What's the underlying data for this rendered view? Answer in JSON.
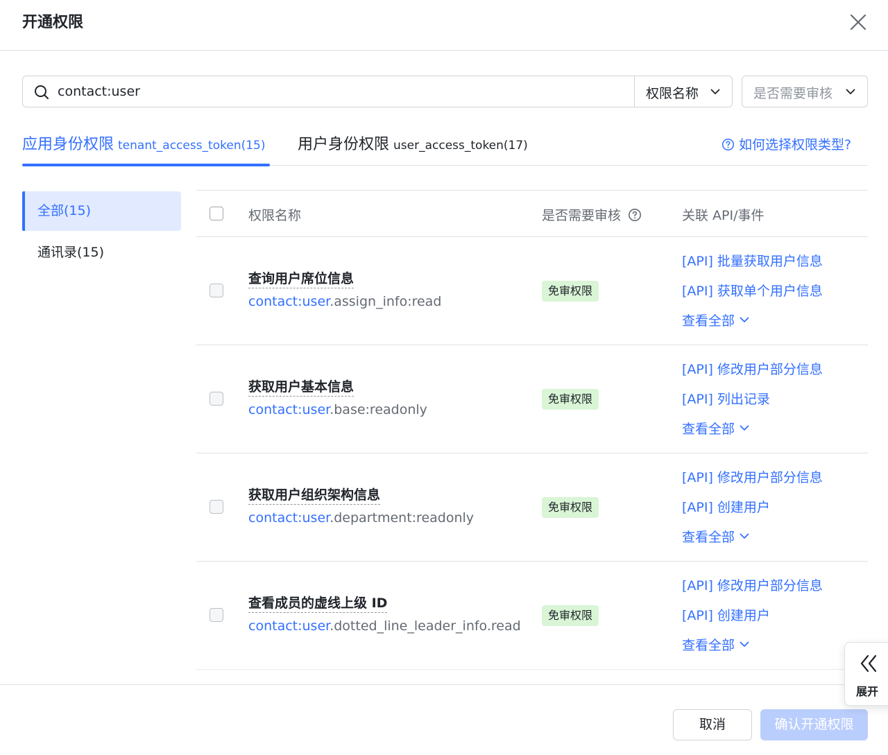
{
  "dialog": {
    "title": "开通权限"
  },
  "search": {
    "value": "contact:user"
  },
  "filters": {
    "field": "权限名称",
    "review": "是否需要审核"
  },
  "tabs": [
    {
      "label": "应用身份权限",
      "token": "tenant_access_token(15)"
    },
    {
      "label": "用户身份权限",
      "token": "user_access_token(17)"
    }
  ],
  "help": {
    "label": "如何选择权限类型?"
  },
  "sidebar": {
    "items": [
      {
        "label": "全部(15)"
      },
      {
        "label": "通讯录(15)"
      }
    ]
  },
  "table": {
    "headers": {
      "name": "权限名称",
      "review": "是否需要审核",
      "api": "关联 API/事件"
    },
    "rows": [
      {
        "name": "查询用户席位信息",
        "code_hl": "contact:user",
        "code_rest": ".assign_info:read",
        "badge": "免审权限",
        "api1": "[API] 批量获取用户信息",
        "api2": "[API] 获取单个用户信息",
        "more": "查看全部"
      },
      {
        "name": "获取用户基本信息",
        "code_hl": "contact:user",
        "code_rest": ".base:readonly",
        "badge": "免审权限",
        "api1": "[API] 修改用户部分信息",
        "api2": "[API] 列出记录",
        "more": "查看全部"
      },
      {
        "name": "获取用户组织架构信息",
        "code_hl": "contact:user",
        "code_rest": ".department:readonly",
        "badge": "免审权限",
        "api1": "[API] 修改用户部分信息",
        "api2": "[API] 创建用户",
        "more": "查看全部"
      },
      {
        "name": "查看成员的虚线上级 ID",
        "code_hl": "contact:user",
        "code_rest": ".dotted_line_leader_info.read",
        "badge": "免审权限",
        "api1": "[API] 修改用户部分信息",
        "api2": "[API] 创建用户",
        "more": "查看全部"
      }
    ]
  },
  "footer": {
    "cancel": "取消",
    "confirm": "确认开通权限"
  },
  "expand": {
    "label": "展开"
  },
  "colors": {
    "accent": "#3370ff",
    "badge_bg": "#d9f5d6",
    "confirm_disabled": "#bacefd",
    "active_bg": "#e1eaff"
  }
}
